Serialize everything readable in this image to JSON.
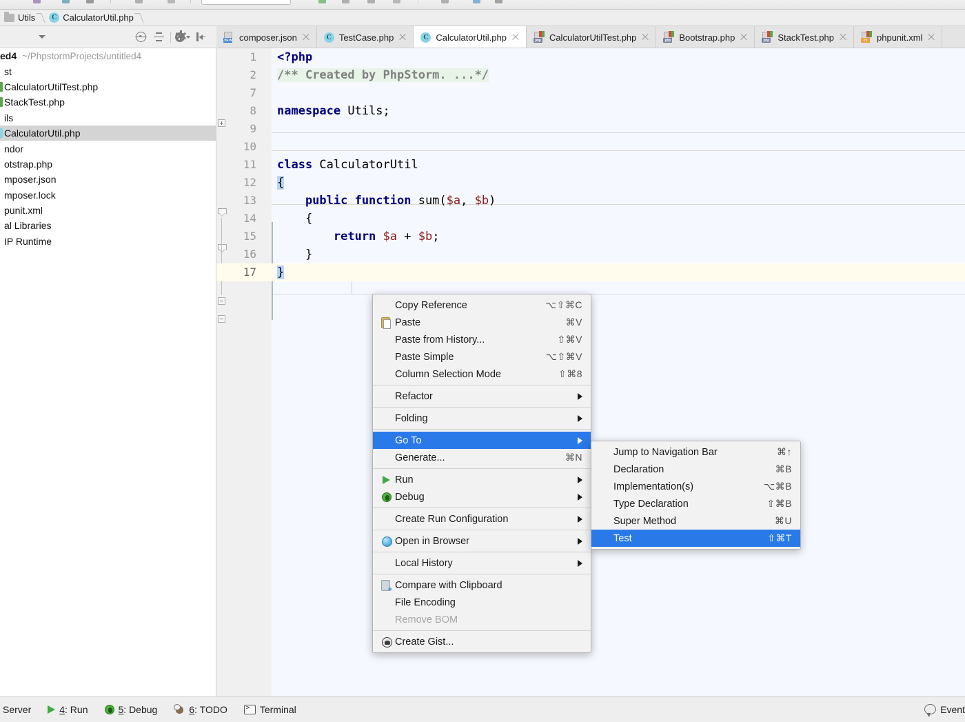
{
  "window": {
    "accent_blue": "#2979e8",
    "editor_bg": "#f6f8ff",
    "current_line_bg": "#fffced"
  },
  "breadcrumb": {
    "items": [
      {
        "label": "Utils",
        "icon": "folder-icon"
      },
      {
        "label": "CalculatorUtil.php",
        "icon": "php-class-icon"
      }
    ]
  },
  "panel_toolbar": {
    "buttons": [
      {
        "name": "locate-in-tree-button",
        "icon": "target-icon"
      },
      {
        "name": "collapse-all-button",
        "icon": "collapse-all-icon"
      },
      {
        "name": "settings-button",
        "icon": "gear-icon"
      },
      {
        "name": "hide-panel-button",
        "icon": "hide-panel-icon"
      }
    ]
  },
  "tabs": [
    {
      "label": "composer.json",
      "type": "json",
      "active": false
    },
    {
      "label": "TestCase.php",
      "type": "class",
      "active": false
    },
    {
      "label": "CalculatorUtil.php",
      "type": "class",
      "active": true
    },
    {
      "label": "CalculatorUtilTest.php",
      "type": "php",
      "active": false
    },
    {
      "label": "Bootstrap.php",
      "type": "php",
      "active": false
    },
    {
      "label": "StackTest.php",
      "type": "php",
      "active": false
    },
    {
      "label": "phpunit.xml",
      "type": "xml",
      "active": false
    }
  ],
  "project_tree": {
    "root": {
      "name": "ed4",
      "path": "~/PhpstormProjects/untitled4"
    },
    "items": [
      {
        "label": "st",
        "icon": "folder-icon",
        "selected": false
      },
      {
        "label": "CalculatorUtilTest.php",
        "icon": "php-test-icon",
        "selected": false
      },
      {
        "label": "StackTest.php",
        "icon": "php-test-icon",
        "selected": false
      },
      {
        "label": "ils",
        "icon": "folder-icon",
        "selected": false
      },
      {
        "label": "CalculatorUtil.php",
        "icon": "php-class-icon",
        "selected": true
      },
      {
        "label": "ndor",
        "icon": "folder-icon",
        "selected": false
      },
      {
        "label": "otstrap.php",
        "icon": "php-icon",
        "selected": false
      },
      {
        "label": "mposer.json",
        "icon": "json-icon",
        "selected": false
      },
      {
        "label": "mposer.lock",
        "icon": "file-icon",
        "selected": false
      },
      {
        "label": "punit.xml",
        "icon": "xml-icon",
        "selected": false
      },
      {
        "label": "al Libraries",
        "icon": "library-icon",
        "selected": false
      },
      {
        "label": "IP Runtime",
        "icon": "library-icon",
        "selected": false
      }
    ]
  },
  "editor": {
    "filename": "CalculatorUtil.php",
    "lines": [
      {
        "num": "1",
        "tokens": [
          {
            "t": "<?php",
            "c": "kw"
          }
        ]
      },
      {
        "num": "2",
        "tokens": [
          {
            "t": "/** Created by PhpStorm. ...*/",
            "c": "cmt"
          }
        ]
      },
      {
        "num": "7",
        "tokens": []
      },
      {
        "num": "8",
        "tokens": [
          {
            "t": "namespace",
            "c": "kw"
          },
          {
            "t": " Utils;",
            "c": "plain"
          }
        ]
      },
      {
        "num": "9",
        "tokens": []
      },
      {
        "num": "10",
        "tokens": []
      },
      {
        "num": "11",
        "tokens": [
          {
            "t": "class",
            "c": "kw"
          },
          {
            "t": " CalculatorUtil",
            "c": "plain"
          }
        ]
      },
      {
        "num": "12",
        "tokens": [
          {
            "t": "{",
            "c": "brace-hl"
          }
        ]
      },
      {
        "num": "13",
        "tokens": [
          {
            "t": "    public function",
            "c": "kw"
          },
          {
            "t": " sum(",
            "c": "plain"
          },
          {
            "t": "$a",
            "c": "var"
          },
          {
            "t": ", ",
            "c": "plain"
          },
          {
            "t": "$b",
            "c": "var"
          },
          {
            "t": ")",
            "c": "plain"
          }
        ]
      },
      {
        "num": "14",
        "tokens": [
          {
            "t": "    {",
            "c": "plain"
          }
        ]
      },
      {
        "num": "15",
        "tokens": [
          {
            "t": "        return",
            "c": "kw"
          },
          {
            "t": " ",
            "c": "plain"
          },
          {
            "t": "$a",
            "c": "var"
          },
          {
            "t": " + ",
            "c": "plain"
          },
          {
            "t": "$b",
            "c": "var"
          },
          {
            "t": ";",
            "c": "plain"
          }
        ]
      },
      {
        "num": "16",
        "tokens": [
          {
            "t": "    }",
            "c": "plain"
          }
        ]
      },
      {
        "num": "17",
        "tokens": [
          {
            "t": "}",
            "c": "brace-hl"
          }
        ],
        "current": true
      }
    ]
  },
  "context_menu": {
    "groups": [
      {
        "items": [
          {
            "label": "Copy Reference",
            "shortcut": "⌥⇧⌘C",
            "icon": null
          },
          {
            "label": "Paste",
            "shortcut": "⌘V",
            "icon": "clipboard-icon"
          },
          {
            "label": "Paste from History...",
            "shortcut": "⇧⌘V",
            "icon": null
          },
          {
            "label": "Paste Simple",
            "shortcut": "⌥⇧⌘V",
            "icon": null
          },
          {
            "label": "Column Selection Mode",
            "shortcut": "⇧⌘8",
            "icon": null
          }
        ]
      },
      {
        "items": [
          {
            "label": "Refactor",
            "submenu": true,
            "icon": null
          }
        ]
      },
      {
        "items": [
          {
            "label": "Folding",
            "submenu": true,
            "icon": null
          }
        ]
      },
      {
        "items": [
          {
            "label": "Go To",
            "submenu": true,
            "selected": true,
            "icon": null
          },
          {
            "label": "Generate...",
            "shortcut": "⌘N",
            "icon": null
          }
        ]
      },
      {
        "items": [
          {
            "label": "Run",
            "submenu": true,
            "icon": "run-icon"
          },
          {
            "label": "Debug",
            "submenu": true,
            "icon": "bug-icon"
          }
        ]
      },
      {
        "items": [
          {
            "label": "Create Run Configuration",
            "submenu": true,
            "icon": null
          }
        ]
      },
      {
        "items": [
          {
            "label": "Open in Browser",
            "submenu": true,
            "icon": "globe-icon"
          }
        ]
      },
      {
        "items": [
          {
            "label": "Local History",
            "submenu": true,
            "icon": null
          }
        ]
      },
      {
        "items": [
          {
            "label": "Compare with Clipboard",
            "icon": "clipboard-compare-icon"
          },
          {
            "label": "File Encoding",
            "icon": null
          },
          {
            "label": "Remove BOM",
            "icon": null,
            "disabled": true
          }
        ]
      },
      {
        "items": [
          {
            "label": "Create Gist...",
            "icon": "gist-icon"
          }
        ]
      }
    ]
  },
  "goto_submenu": {
    "items": [
      {
        "label": "Jump to Navigation Bar",
        "shortcut": "⌘↑"
      },
      {
        "label": "Declaration",
        "shortcut": "⌘B"
      },
      {
        "label": "Implementation(s)",
        "shortcut": "⌥⌘B"
      },
      {
        "label": "Type Declaration",
        "shortcut": "⇧⌘B"
      },
      {
        "label": "Super Method",
        "shortcut": "⌘U"
      },
      {
        "label": "Test",
        "shortcut": "⇧⌘T",
        "selected": true
      }
    ]
  },
  "statusbar": {
    "items": [
      {
        "label": "Server",
        "icon": null,
        "underline": ""
      },
      {
        "label": ": Run",
        "icon": "run-icon",
        "underline": "4"
      },
      {
        "label": ": Debug",
        "icon": "bug-icon",
        "underline": "5"
      },
      {
        "label": ": TODO",
        "icon": "todo-icon",
        "underline": "6"
      },
      {
        "label": "Terminal",
        "icon": "terminal-icon",
        "underline": ""
      }
    ],
    "right": {
      "label": "Event",
      "icon": "event-log-icon"
    }
  }
}
